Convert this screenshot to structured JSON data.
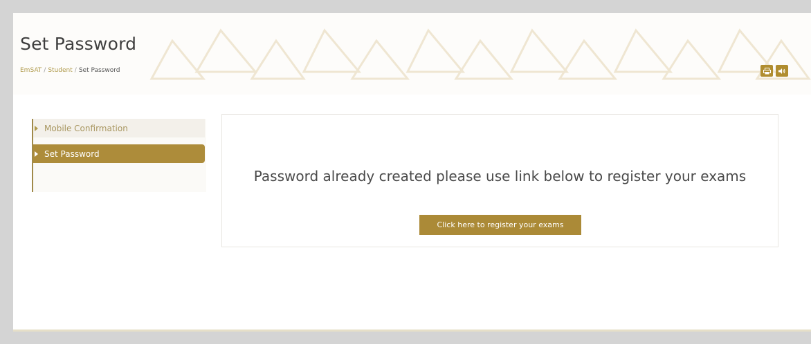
{
  "header": {
    "title": "Set Password",
    "breadcrumb": [
      "EmSAT",
      "Student",
      "Set Password"
    ],
    "print_icon": "print-icon",
    "audio_icon": "speaker-icon"
  },
  "sidebar": {
    "items": [
      {
        "label": "Mobile Confirmation",
        "active": false
      },
      {
        "label": "Set Password",
        "active": true
      }
    ]
  },
  "main": {
    "message": "Password already created please use link below to register your exams",
    "register_button": "Click here to register your exams"
  },
  "colors": {
    "accent": "#ab8a37",
    "background": "#d4d4d4",
    "text": "#4a4a4a"
  }
}
